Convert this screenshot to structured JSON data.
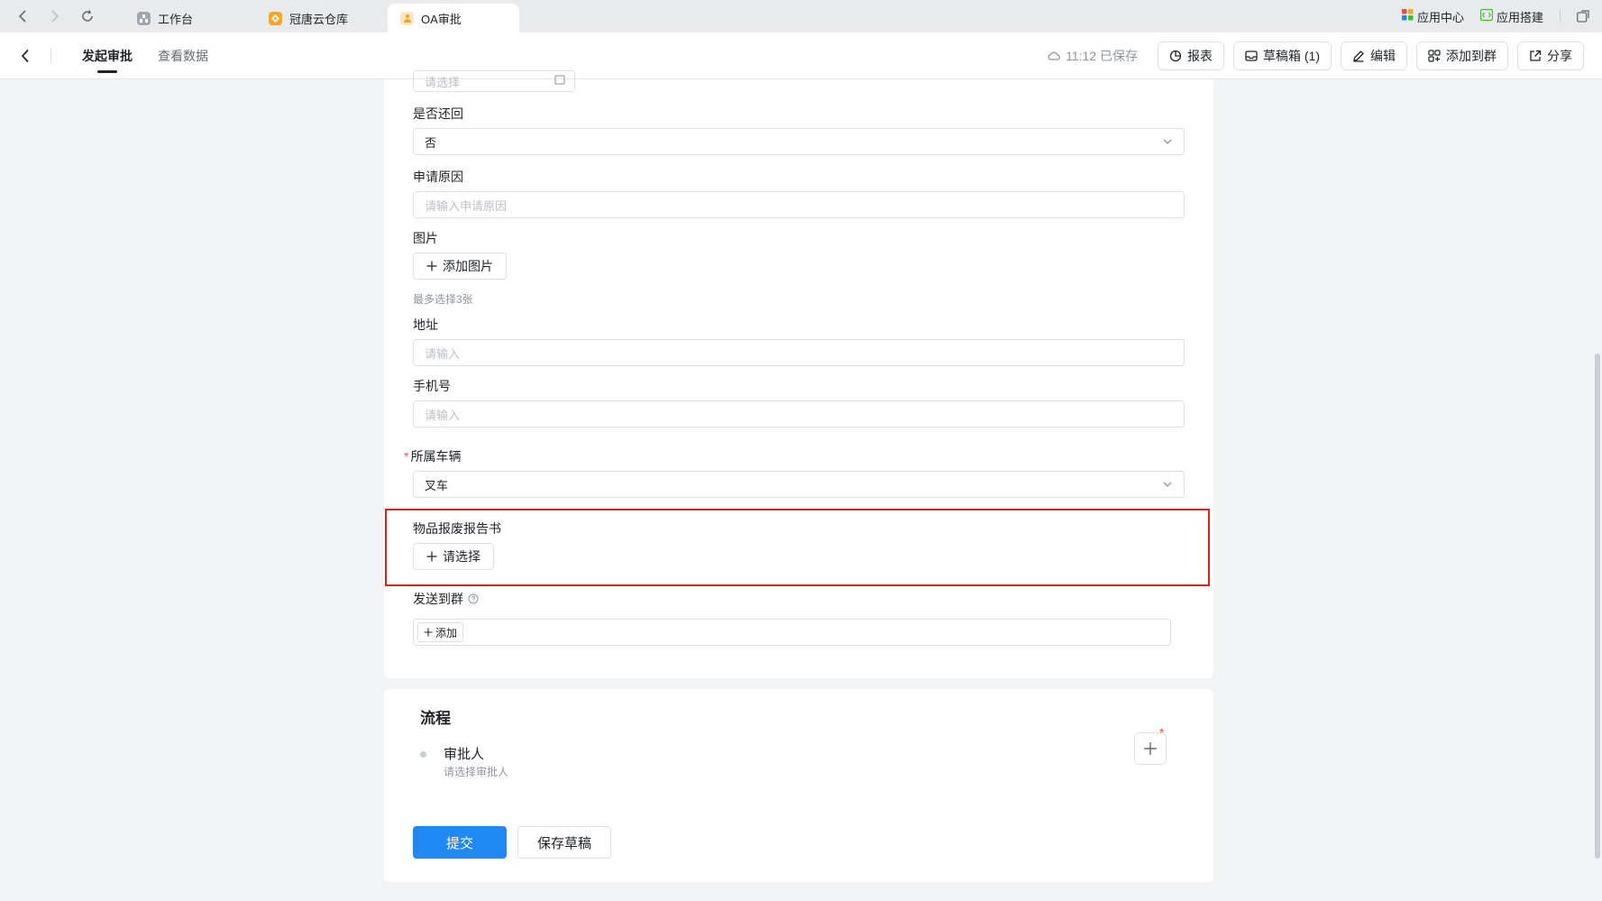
{
  "browser": {
    "tabs": [
      {
        "label": "工作台",
        "icon": "workbench-icon",
        "color": "#8f959e"
      },
      {
        "label": "冠唐云仓库",
        "icon": "warehouse-icon",
        "color": "#f5a623"
      },
      {
        "label": "OA审批",
        "icon": "oa-user-icon",
        "color": "#f5a623"
      }
    ],
    "right": {
      "app_center": "应用中心",
      "app_build": "应用搭建"
    }
  },
  "header": {
    "tabs": [
      "发起审批",
      "查看数据"
    ],
    "saved_time": "11:12 已保存",
    "buttons": {
      "report": "报表",
      "drafts": "草稿箱 (1)",
      "edit": "编辑",
      "add_to_group": "添加到群",
      "share": "分享"
    }
  },
  "form": {
    "partial_placeholder": "请选择",
    "return": {
      "label": "是否还回",
      "value": "否"
    },
    "reason": {
      "label": "申请原因",
      "placeholder": "请输入申请原因"
    },
    "image": {
      "label": "图片",
      "button": "添加图片",
      "hint": "最多选择3张"
    },
    "address": {
      "label": "地址",
      "placeholder": "请输入"
    },
    "phone": {
      "label": "手机号",
      "placeholder": "请输入"
    },
    "vehicle": {
      "label": "所属车辆",
      "required_mark": "*",
      "value": "叉车"
    },
    "scrap_report": {
      "label": "物品报废报告书",
      "button": "请选择"
    },
    "send_group": {
      "label": "发送到群",
      "button": "添加"
    }
  },
  "process": {
    "title": "流程",
    "approver_label": "审批人",
    "approver_hint": "请选择审批人",
    "required_mark": "*"
  },
  "actions": {
    "submit": "提交",
    "save_draft": "保存草稿"
  },
  "colors": {
    "primary": "#1e88f5",
    "highlight": "#e02020",
    "required": "#f54a45"
  }
}
